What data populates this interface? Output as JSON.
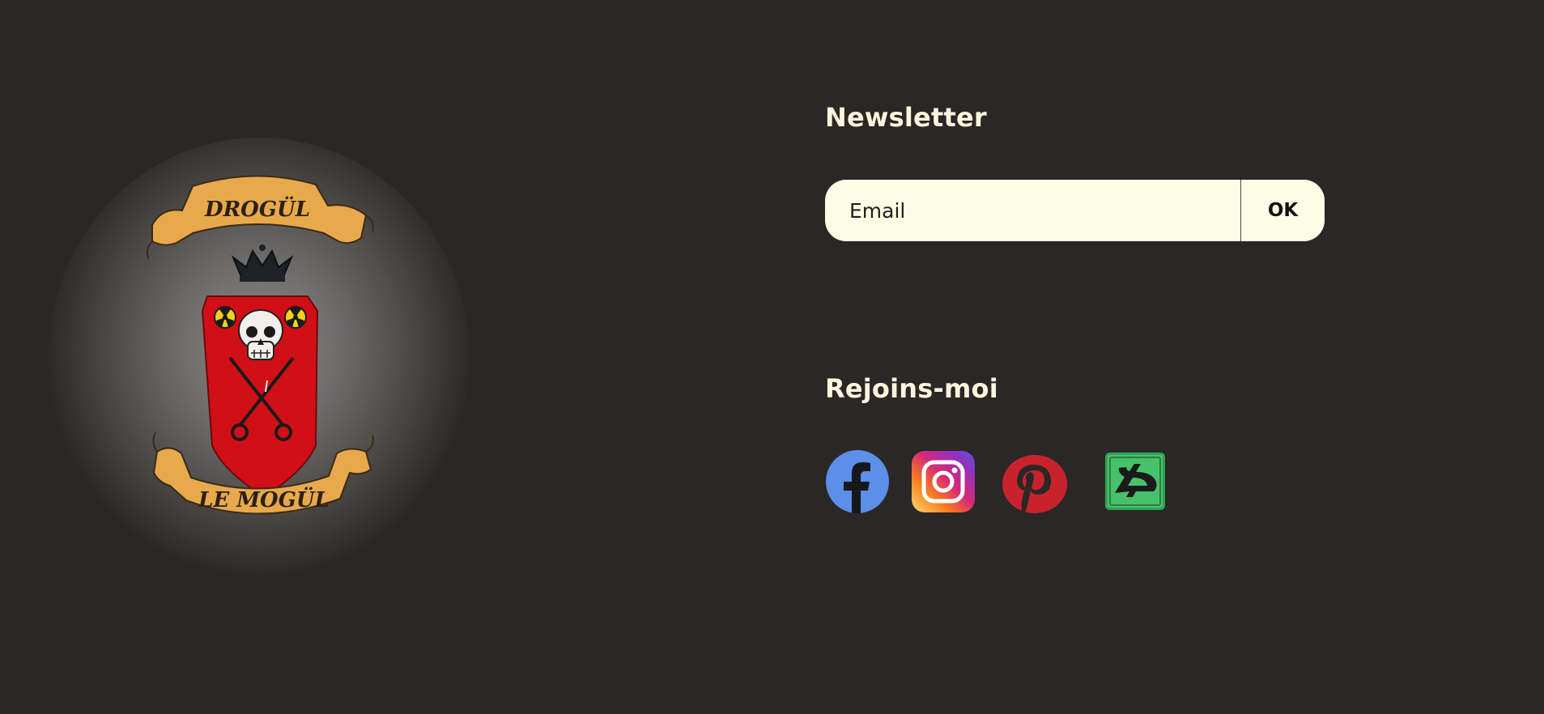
{
  "crest": {
    "banner_top_text": "DROGÜL",
    "banner_bottom_text": "LE MOGÜL"
  },
  "newsletter": {
    "title": "Newsletter",
    "email_placeholder": "Email",
    "email_value": "",
    "submit_label": "OK"
  },
  "social": {
    "title": "Rejoins-moi",
    "links": [
      {
        "icon": "facebook-icon",
        "color": "#5b8fe8"
      },
      {
        "icon": "instagram-icon",
        "color": "#d62976"
      },
      {
        "icon": "pinterest-icon",
        "color": "#c8232c"
      },
      {
        "icon": "deviantart-icon",
        "color": "#47c26a"
      }
    ]
  },
  "colors": {
    "background": "#2b2726",
    "heading": "#fbf5dd",
    "input_bg": "#fdfde5",
    "shield_red": "#d10f16",
    "banner_gold": "#e8a94c"
  }
}
